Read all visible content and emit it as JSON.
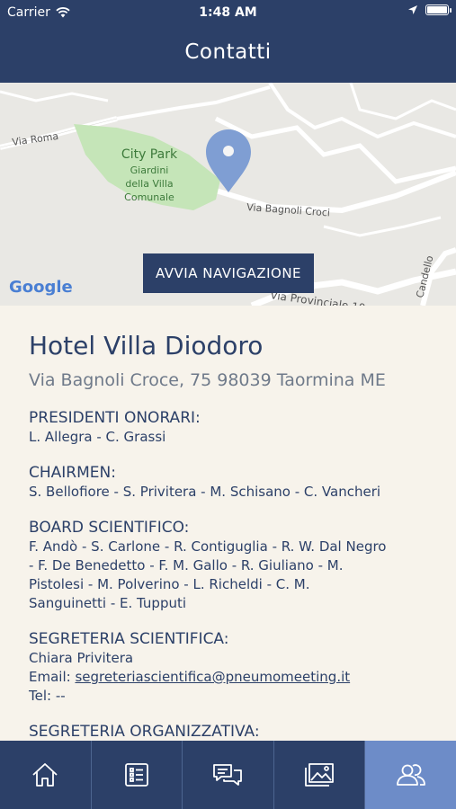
{
  "status": {
    "carrier": "Carrier",
    "time": "1:48 AM"
  },
  "header": {
    "title": "Contatti"
  },
  "map": {
    "roads": [
      "Via Roma",
      "Via Bagnoli Croci",
      "Via Provinciale 10",
      "Candello"
    ],
    "park": {
      "name": "City Park",
      "subtitle": [
        "Giardini",
        "della Villa",
        "Comunale"
      ]
    },
    "logo": "Google",
    "nav_button": "AVVIA NAVIGAZIONE",
    "pin_color": "#7f9ed3"
  },
  "hotel": {
    "name": "Hotel Villa Diodoro",
    "address": "Via Bagnoli Croce, 75 98039 Taormina ME"
  },
  "sections": [
    {
      "title": "PRESIDENTI ONORARI:",
      "lines": [
        "L. Allegra - C. Grassi"
      ]
    },
    {
      "title": "CHAIRMEN:",
      "lines": [
        "S. Bellofiore - S. Privitera - M. Schisano - C. Vancheri"
      ]
    },
    {
      "title": "BOARD SCIENTIFICO:",
      "lines": [
        "F. Andò - S. Carlone - R. Contiguglia - R. W. Dal Negro",
        "- F. De Benedetto - F. M. Gallo - R. Giuliano - M.",
        "Pistolesi - M. Polverino - L. Richeldi - C. M.",
        "Sanguinetti - E. Tupputi"
      ]
    },
    {
      "title": "SEGRETERIA SCIENTIFICA:",
      "name": "Chiara Privitera",
      "email_label": "Email: ",
      "email": "segreteriascientifica@pneumomeeting.it",
      "tel": "Tel: --"
    },
    {
      "title": "SEGRETERIA ORGANIZZATIVA:"
    }
  ],
  "tabs": [
    {
      "icon": "home-icon",
      "active": false
    },
    {
      "icon": "list-icon",
      "active": false
    },
    {
      "icon": "chat-icon",
      "active": false
    },
    {
      "icon": "gallery-icon",
      "active": false
    },
    {
      "icon": "contacts-icon",
      "active": true
    }
  ],
  "colors": {
    "primary": "#2c4068",
    "active_tab": "#6d8cc8",
    "background": "#f7f3eb"
  }
}
